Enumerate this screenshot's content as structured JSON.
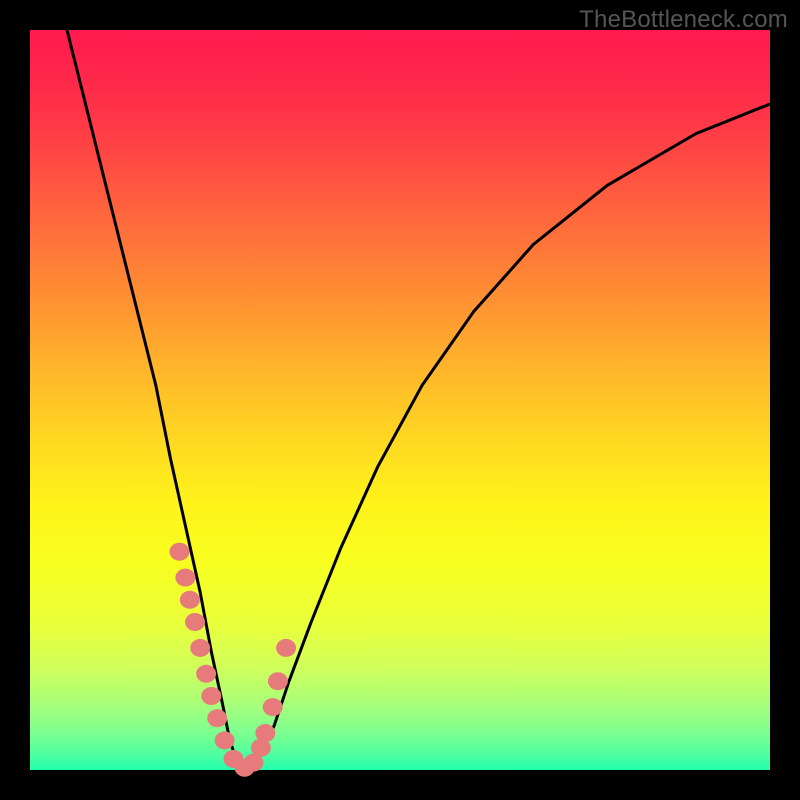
{
  "watermark": "TheBottleneck.com",
  "chart_data": {
    "type": "line",
    "title": "",
    "xlabel": "",
    "ylabel": "",
    "xlim": [
      0,
      100
    ],
    "ylim": [
      0,
      100
    ],
    "series": [
      {
        "name": "bottleneck-curve",
        "x": [
          5,
          8,
          11,
          14,
          17,
          19,
          21,
          23,
          24.5,
          26,
          27,
          28,
          29,
          30,
          31,
          33,
          35,
          38,
          42,
          47,
          53,
          60,
          68,
          78,
          90,
          100
        ],
        "y": [
          100,
          88,
          76,
          64,
          52,
          42,
          33,
          24,
          16,
          9,
          4,
          1,
          0,
          0.5,
          2,
          6,
          12,
          20,
          30,
          41,
          52,
          62,
          71,
          79,
          86,
          90
        ]
      }
    ],
    "markers": {
      "name": "highlight-points",
      "x": [
        20.2,
        21.0,
        21.6,
        22.3,
        23.0,
        23.8,
        24.5,
        25.3,
        26.3,
        27.5,
        29.0,
        30.2,
        31.2,
        31.8,
        32.8,
        33.5,
        34.6
      ],
      "y": [
        29.5,
        26.0,
        23.0,
        20.0,
        16.5,
        13.0,
        10.0,
        7.0,
        4.0,
        1.5,
        0.3,
        1.0,
        3.0,
        5.0,
        8.5,
        12.0,
        16.5
      ]
    },
    "marker_color": "#e77b7b",
    "curve_color": "#000000"
  }
}
